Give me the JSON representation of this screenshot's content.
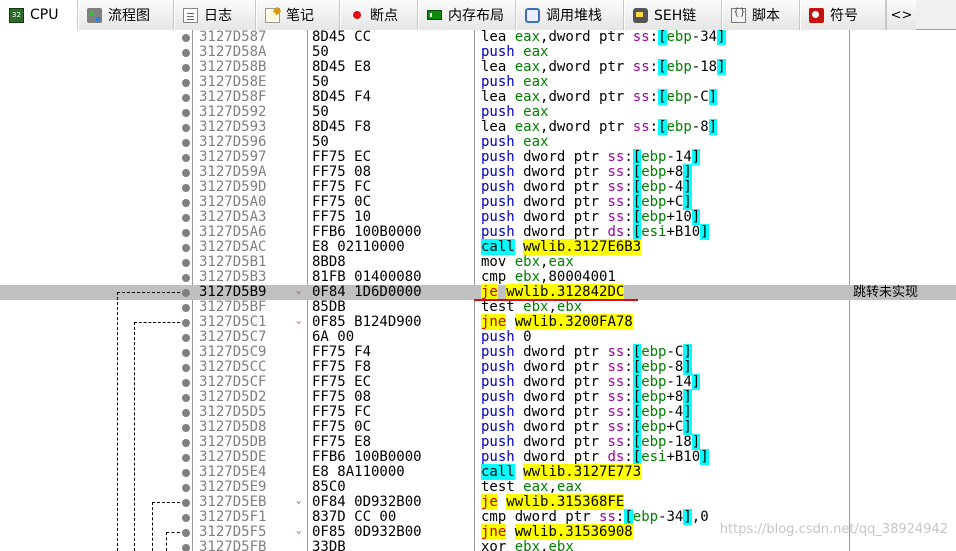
{
  "tabs": [
    {
      "key": "cpu",
      "label": "CPU",
      "icon": "cpu-icon",
      "active": true
    },
    {
      "key": "graph",
      "label": "流程图",
      "icon": "graph-icon"
    },
    {
      "key": "log",
      "label": "日志",
      "icon": "log-icon"
    },
    {
      "key": "notes",
      "label": "笔记",
      "icon": "notes-icon"
    },
    {
      "key": "breakpoints",
      "label": "断点",
      "icon": "breakpoint-icon"
    },
    {
      "key": "memmap",
      "label": "内存布局",
      "icon": "memory-map-icon"
    },
    {
      "key": "callstack",
      "label": "调用堆栈",
      "icon": "call-stack-icon"
    },
    {
      "key": "seh",
      "label": "SEH链",
      "icon": "seh-icon"
    },
    {
      "key": "script",
      "label": "脚本",
      "icon": "script-icon"
    },
    {
      "key": "symbols",
      "label": "符号",
      "icon": "symbols-icon"
    }
  ],
  "tab_nav_label": "<>",
  "cpu_icon_text": "32",
  "selected_row": 17,
  "rows": [
    {
      "addr": "3127D587",
      "bytes": "8D45 CC",
      "asm": "lea eax,dword ptr ss:[ebp-34]"
    },
    {
      "addr": "3127D58A",
      "bytes": "50",
      "asm": "push eax"
    },
    {
      "addr": "3127D58B",
      "bytes": "8D45 E8",
      "asm": "lea eax,dword ptr ss:[ebp-18]"
    },
    {
      "addr": "3127D58E",
      "bytes": "50",
      "asm": "push eax"
    },
    {
      "addr": "3127D58F",
      "bytes": "8D45 F4",
      "asm": "lea eax,dword ptr ss:[ebp-C]"
    },
    {
      "addr": "3127D592",
      "bytes": "50",
      "asm": "push eax"
    },
    {
      "addr": "3127D593",
      "bytes": "8D45 F8",
      "asm": "lea eax,dword ptr ss:[ebp-8]"
    },
    {
      "addr": "3127D596",
      "bytes": "50",
      "asm": "push eax"
    },
    {
      "addr": "3127D597",
      "bytes": "FF75 EC",
      "asm": "push dword ptr ss:[ebp-14]"
    },
    {
      "addr": "3127D59A",
      "bytes": "FF75 08",
      "asm": "push dword ptr ss:[ebp+8]"
    },
    {
      "addr": "3127D59D",
      "bytes": "FF75 FC",
      "asm": "push dword ptr ss:[ebp-4]"
    },
    {
      "addr": "3127D5A0",
      "bytes": "FF75 0C",
      "asm": "push dword ptr ss:[ebp+C]"
    },
    {
      "addr": "3127D5A3",
      "bytes": "FF75 10",
      "asm": "push dword ptr ss:[ebp+10]"
    },
    {
      "addr": "3127D5A6",
      "bytes": "FFB6 100B0000",
      "asm": "push dword ptr ds:[esi+B10]"
    },
    {
      "addr": "3127D5AC",
      "bytes": "E8 02110000",
      "asm": "call wwlib.3127E6B3"
    },
    {
      "addr": "3127D5B1",
      "bytes": "8BD8",
      "asm": "mov ebx,eax"
    },
    {
      "addr": "3127D5B3",
      "bytes": "81FB 01400080",
      "asm": "cmp ebx,80004001"
    },
    {
      "addr": "3127D5B9",
      "bytes": "0F84 1D6D0000",
      "asm": "je wwlib.312842DC",
      "comment": "跳转未实现",
      "fold": true
    },
    {
      "addr": "3127D5BF",
      "bytes": "85DB",
      "asm": "test ebx,ebx"
    },
    {
      "addr": "3127D5C1",
      "bytes": "0F85 B124D900",
      "asm": "jne wwlib.3200FA78",
      "fold": true
    },
    {
      "addr": "3127D5C7",
      "bytes": "6A 00",
      "asm": "push 0"
    },
    {
      "addr": "3127D5C9",
      "bytes": "FF75 F4",
      "asm": "push dword ptr ss:[ebp-C]"
    },
    {
      "addr": "3127D5CC",
      "bytes": "FF75 F8",
      "asm": "push dword ptr ss:[ebp-8]"
    },
    {
      "addr": "3127D5CF",
      "bytes": "FF75 EC",
      "asm": "push dword ptr ss:[ebp-14]"
    },
    {
      "addr": "3127D5D2",
      "bytes": "FF75 08",
      "asm": "push dword ptr ss:[ebp+8]"
    },
    {
      "addr": "3127D5D5",
      "bytes": "FF75 FC",
      "asm": "push dword ptr ss:[ebp-4]"
    },
    {
      "addr": "3127D5D8",
      "bytes": "FF75 0C",
      "asm": "push dword ptr ss:[ebp+C]"
    },
    {
      "addr": "3127D5DB",
      "bytes": "FF75 E8",
      "asm": "push dword ptr ss:[ebp-18]"
    },
    {
      "addr": "3127D5DE",
      "bytes": "FFB6 100B0000",
      "asm": "push dword ptr ds:[esi+B10]"
    },
    {
      "addr": "3127D5E4",
      "bytes": "E8 8A110000",
      "asm": "call wwlib.3127E773"
    },
    {
      "addr": "3127D5E9",
      "bytes": "85C0",
      "asm": "test eax,eax"
    },
    {
      "addr": "3127D5EB",
      "bytes": "0F84 0D932B00",
      "asm": "je wwlib.315368FE",
      "fold": true
    },
    {
      "addr": "3127D5F1",
      "bytes": "837D CC 00",
      "asm": "cmp dword ptr ss:[ebp-34],0"
    },
    {
      "addr": "3127D5F5",
      "bytes": "0F85 0D932B00",
      "asm": "jne wwlib.31536908",
      "fold": true
    },
    {
      "addr": "3127D5FB",
      "bytes": "33DB",
      "asm": "xor ebx,ebx"
    }
  ],
  "watermark": "https://blog.csdn.net/qq_38924942",
  "colors": {
    "address_gray": "#808080",
    "push_blue": "#0000c0",
    "register_green": "#008000",
    "segment_purple": "#a000a0",
    "call_highlight": "#00ffff",
    "jump_highlight": "#ffff00",
    "jump_text_red": "#c00000",
    "selection_gray": "#c0c0c0"
  }
}
